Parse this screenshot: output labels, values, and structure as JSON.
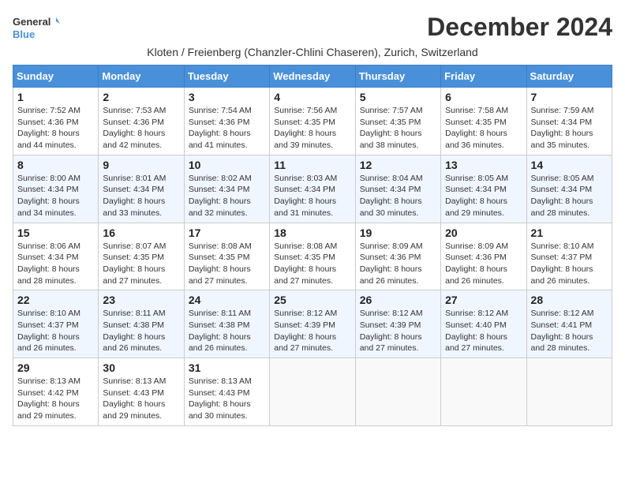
{
  "header": {
    "logo_line1": "General",
    "logo_line2": "Blue",
    "title": "December 2024",
    "subtitle": "Kloten / Freienberg (Chanzler-Chlini Chaseren), Zurich, Switzerland"
  },
  "weekdays": [
    "Sunday",
    "Monday",
    "Tuesday",
    "Wednesday",
    "Thursday",
    "Friday",
    "Saturday"
  ],
  "weeks": [
    [
      {
        "day": 1,
        "sunrise": "7:52 AM",
        "sunset": "4:36 PM",
        "daylight": "8 hours and 44 minutes."
      },
      {
        "day": 2,
        "sunrise": "7:53 AM",
        "sunset": "4:36 PM",
        "daylight": "8 hours and 42 minutes."
      },
      {
        "day": 3,
        "sunrise": "7:54 AM",
        "sunset": "4:36 PM",
        "daylight": "8 hours and 41 minutes."
      },
      {
        "day": 4,
        "sunrise": "7:56 AM",
        "sunset": "4:35 PM",
        "daylight": "8 hours and 39 minutes."
      },
      {
        "day": 5,
        "sunrise": "7:57 AM",
        "sunset": "4:35 PM",
        "daylight": "8 hours and 38 minutes."
      },
      {
        "day": 6,
        "sunrise": "7:58 AM",
        "sunset": "4:35 PM",
        "daylight": "8 hours and 36 minutes."
      },
      {
        "day": 7,
        "sunrise": "7:59 AM",
        "sunset": "4:34 PM",
        "daylight": "8 hours and 35 minutes."
      }
    ],
    [
      {
        "day": 8,
        "sunrise": "8:00 AM",
        "sunset": "4:34 PM",
        "daylight": "8 hours and 34 minutes."
      },
      {
        "day": 9,
        "sunrise": "8:01 AM",
        "sunset": "4:34 PM",
        "daylight": "8 hours and 33 minutes."
      },
      {
        "day": 10,
        "sunrise": "8:02 AM",
        "sunset": "4:34 PM",
        "daylight": "8 hours and 32 minutes."
      },
      {
        "day": 11,
        "sunrise": "8:03 AM",
        "sunset": "4:34 PM",
        "daylight": "8 hours and 31 minutes."
      },
      {
        "day": 12,
        "sunrise": "8:04 AM",
        "sunset": "4:34 PM",
        "daylight": "8 hours and 30 minutes."
      },
      {
        "day": 13,
        "sunrise": "8:05 AM",
        "sunset": "4:34 PM",
        "daylight": "8 hours and 29 minutes."
      },
      {
        "day": 14,
        "sunrise": "8:05 AM",
        "sunset": "4:34 PM",
        "daylight": "8 hours and 28 minutes."
      }
    ],
    [
      {
        "day": 15,
        "sunrise": "8:06 AM",
        "sunset": "4:34 PM",
        "daylight": "8 hours and 28 minutes."
      },
      {
        "day": 16,
        "sunrise": "8:07 AM",
        "sunset": "4:35 PM",
        "daylight": "8 hours and 27 minutes."
      },
      {
        "day": 17,
        "sunrise": "8:08 AM",
        "sunset": "4:35 PM",
        "daylight": "8 hours and 27 minutes."
      },
      {
        "day": 18,
        "sunrise": "8:08 AM",
        "sunset": "4:35 PM",
        "daylight": "8 hours and 27 minutes."
      },
      {
        "day": 19,
        "sunrise": "8:09 AM",
        "sunset": "4:36 PM",
        "daylight": "8 hours and 26 minutes."
      },
      {
        "day": 20,
        "sunrise": "8:09 AM",
        "sunset": "4:36 PM",
        "daylight": "8 hours and 26 minutes."
      },
      {
        "day": 21,
        "sunrise": "8:10 AM",
        "sunset": "4:37 PM",
        "daylight": "8 hours and 26 minutes."
      }
    ],
    [
      {
        "day": 22,
        "sunrise": "8:10 AM",
        "sunset": "4:37 PM",
        "daylight": "8 hours and 26 minutes."
      },
      {
        "day": 23,
        "sunrise": "8:11 AM",
        "sunset": "4:38 PM",
        "daylight": "8 hours and 26 minutes."
      },
      {
        "day": 24,
        "sunrise": "8:11 AM",
        "sunset": "4:38 PM",
        "daylight": "8 hours and 26 minutes."
      },
      {
        "day": 25,
        "sunrise": "8:12 AM",
        "sunset": "4:39 PM",
        "daylight": "8 hours and 27 minutes."
      },
      {
        "day": 26,
        "sunrise": "8:12 AM",
        "sunset": "4:39 PM",
        "daylight": "8 hours and 27 minutes."
      },
      {
        "day": 27,
        "sunrise": "8:12 AM",
        "sunset": "4:40 PM",
        "daylight": "8 hours and 27 minutes."
      },
      {
        "day": 28,
        "sunrise": "8:12 AM",
        "sunset": "4:41 PM",
        "daylight": "8 hours and 28 minutes."
      }
    ],
    [
      {
        "day": 29,
        "sunrise": "8:13 AM",
        "sunset": "4:42 PM",
        "daylight": "8 hours and 29 minutes."
      },
      {
        "day": 30,
        "sunrise": "8:13 AM",
        "sunset": "4:43 PM",
        "daylight": "8 hours and 29 minutes."
      },
      {
        "day": 31,
        "sunrise": "8:13 AM",
        "sunset": "4:43 PM",
        "daylight": "8 hours and 30 minutes."
      },
      null,
      null,
      null,
      null
    ]
  ]
}
